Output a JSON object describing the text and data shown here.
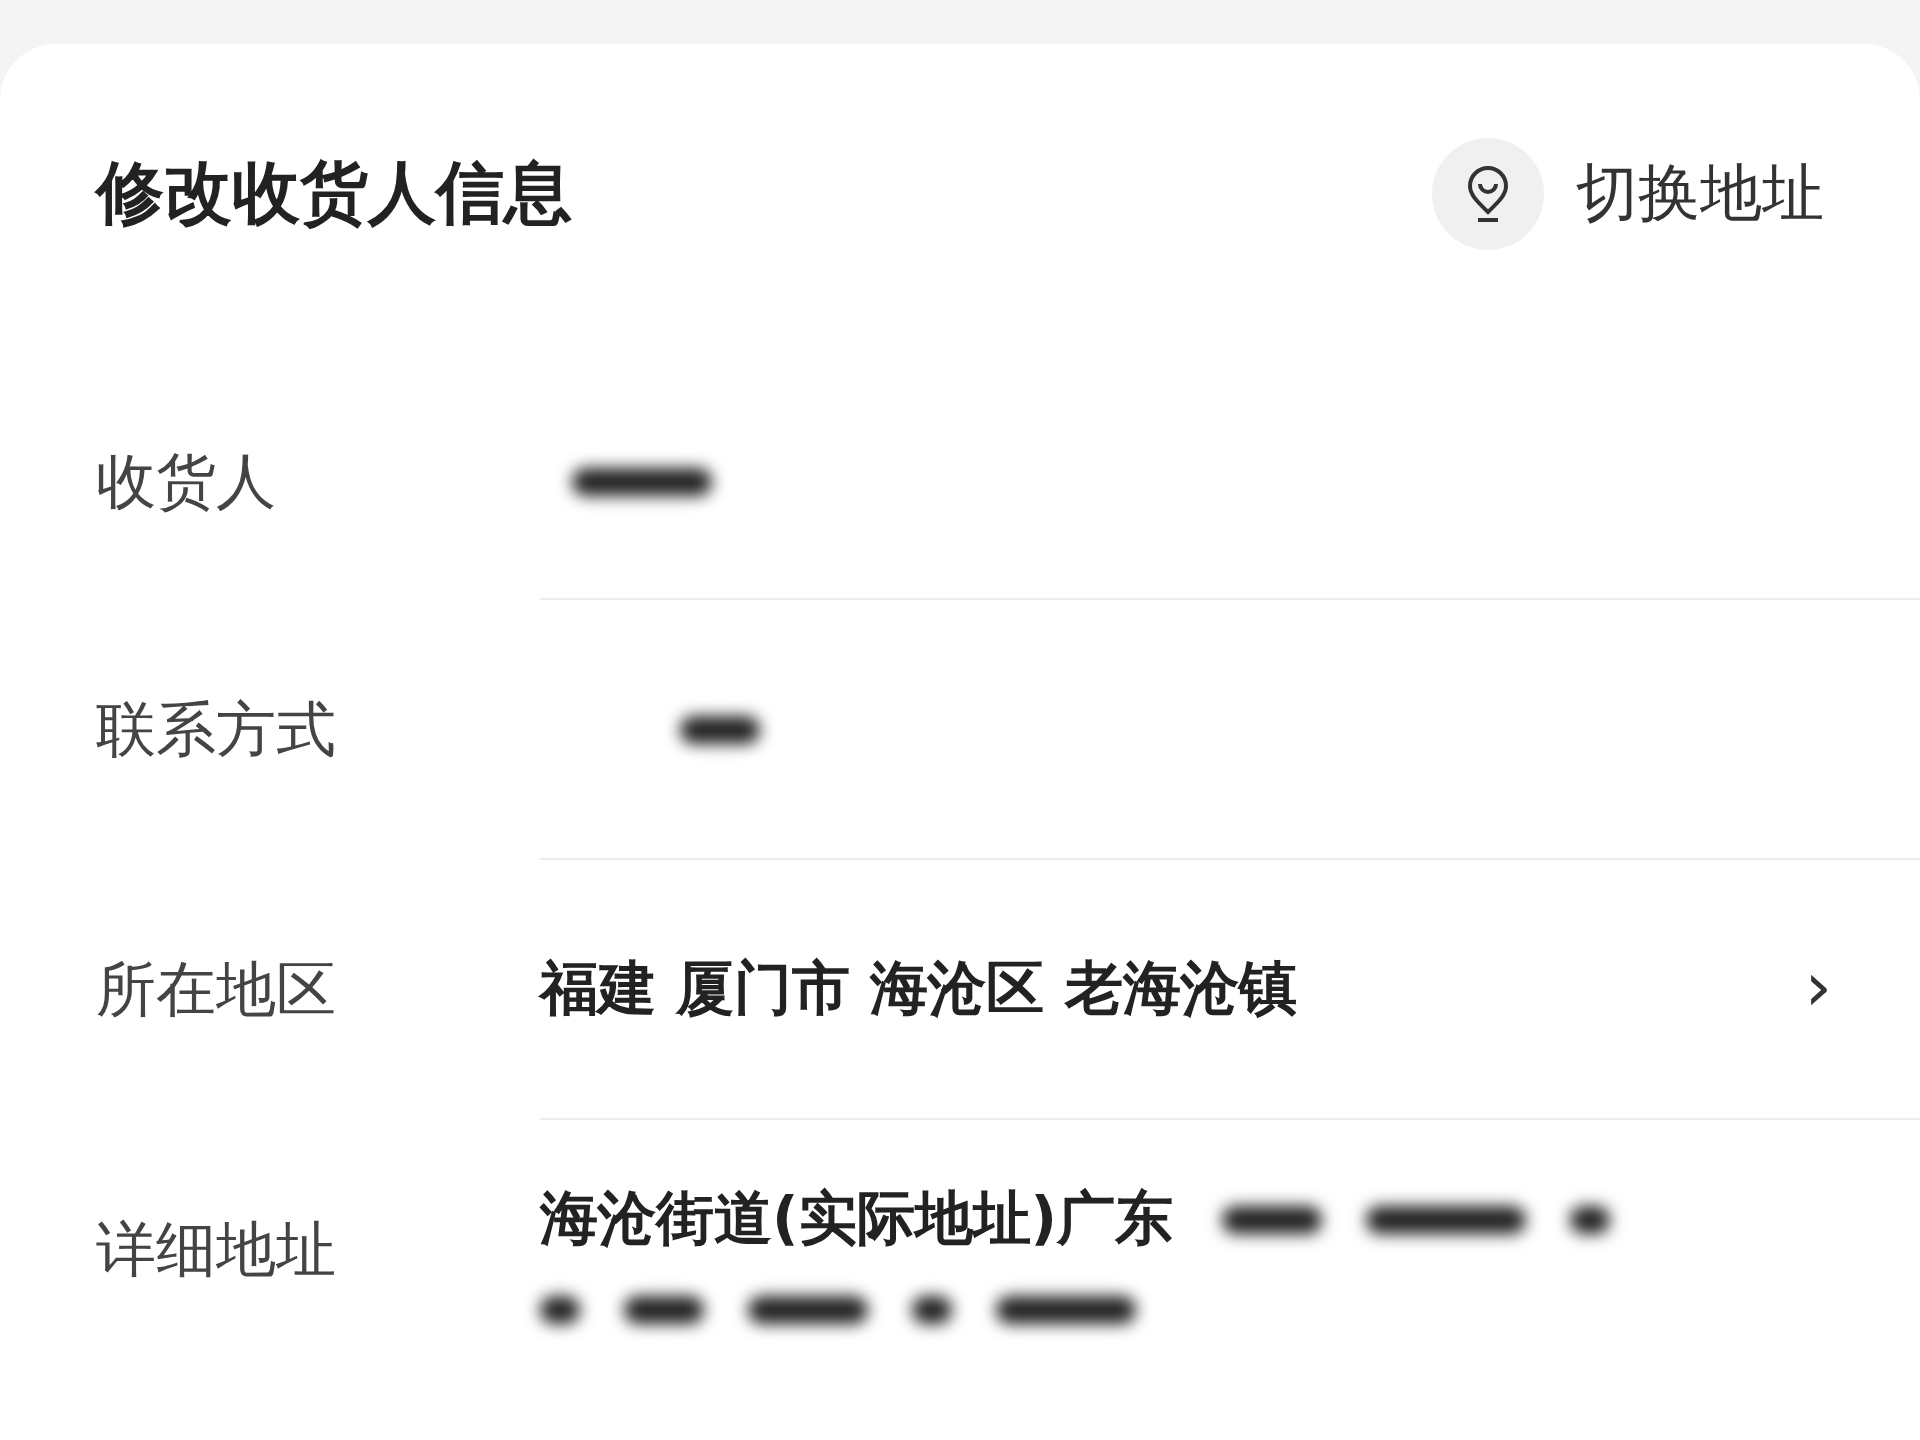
{
  "header": {
    "title": "修改收货人信息",
    "switch_button": "切换地址"
  },
  "fields": [
    {
      "label": "收货人",
      "redacted": true,
      "chevron": false
    },
    {
      "label": "联系方式",
      "redacted": true,
      "chevron": false
    },
    {
      "label": "所在地区",
      "value": "福建 厦门市 海沧区 老海沧镇",
      "redacted": false,
      "chevron": true,
      "chevron_text": "›"
    },
    {
      "label": "详细地址",
      "value": "海沧街道(实际地址)广东",
      "redacted": true,
      "chevron": false
    }
  ]
}
